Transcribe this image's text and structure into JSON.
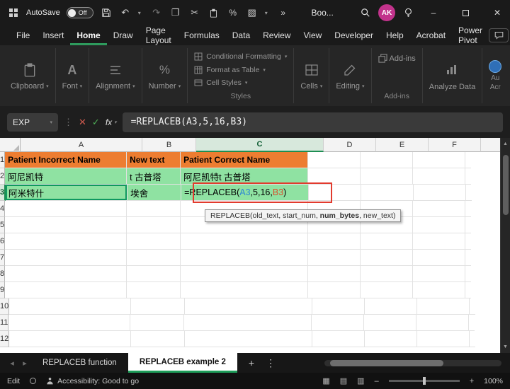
{
  "colors": {
    "accent_green": "#2e9b5d",
    "header_orange": "#ED7D31",
    "cell_green": "#8fe2a2",
    "ref_blue": "#2e86d4",
    "ref_red": "#d94f2b",
    "annotation_red": "#e23b2e",
    "avatar_pink": "#c2338c"
  },
  "title_bar": {
    "autosave_label": "AutoSave",
    "autosave_state": "Off",
    "document_title": "Boo...",
    "avatar_initials": "AK",
    "close_glyph": "✕",
    "minimize_glyph": "–"
  },
  "icons": {
    "undo": "↶",
    "redo": "↷",
    "copy": "❐",
    "cut": "✂",
    "paint": "▨",
    "percent": "%",
    "more": "»",
    "chevron_down": "▾",
    "dots_v": "⋮",
    "nav_left": "◂",
    "nav_right": "▸",
    "add_sheet": "+",
    "view_normal": "▦",
    "view_layout": "▤",
    "view_break": "▥",
    "zoom_out": "–",
    "zoom_in": "+",
    "scroll_up": "▲",
    "scroll_down": "▼",
    "cancel": "✕",
    "enter": "✓"
  },
  "menu_bar": {
    "items": [
      "File",
      "Insert",
      "Home",
      "Draw",
      "Page Layout",
      "Formulas",
      "Data",
      "Review",
      "View",
      "Developer",
      "Help",
      "Acrobat",
      "Power Pivot"
    ],
    "active_item": "Home"
  },
  "ribbon": {
    "groups": [
      {
        "label": "Clipboard"
      },
      {
        "label": "Font"
      },
      {
        "label": "Alignment"
      },
      {
        "label": "Number"
      }
    ],
    "styles_group": {
      "items": [
        "Conditional Formatting",
        "Format as Table",
        "Cell Styles"
      ],
      "label": "Styles"
    },
    "cells_label": "Cells",
    "editing_label": "Editing",
    "addins_button": "Add-ins",
    "addins_label": "Add-ins",
    "analyze_button": "Analyze Data",
    "partial_group": {
      "line1": "Au",
      "line2": "Acr"
    }
  },
  "formula_bar": {
    "name_box": "EXP",
    "fx_label": "fx",
    "formula": "=REPLACEB(A3,5,16,B3)"
  },
  "grid": {
    "column_headers": [
      "A",
      "B",
      "C",
      "D",
      "E",
      "F"
    ],
    "selected_column": "C",
    "row_headers": [
      "1",
      "2",
      "3",
      "4",
      "5",
      "6",
      "7",
      "8",
      "9",
      "10",
      "11",
      "12"
    ],
    "selected_row": "3",
    "cells": {
      "A1": "Patient Incorrect Name",
      "B1": "New text",
      "C1": "Patient Correct Name",
      "A2": "阿尼凯特",
      "B2": "t 古普塔",
      "C2": "阿尼凯特t 古普塔",
      "A3": "阿米特什",
      "B3": "埃舍"
    },
    "c3_formula": {
      "p1": "=REPLACEB(",
      "ref1": "A3",
      "p2": ",5,16,",
      "ref2": "B3",
      "p3": ")"
    },
    "tooltip": {
      "pre": "REPLACEB(old_text, start_num, ",
      "bold": "num_bytes",
      "post": ", new_text)"
    }
  },
  "sheet_tabs": {
    "tabs": [
      {
        "label": "REPLACEB function",
        "active": false
      },
      {
        "label": "REPLACEB example 2",
        "active": true
      }
    ]
  },
  "status_bar": {
    "mode": "Edit",
    "accessibility": "Accessibility: Good to go",
    "zoom_level": "100%"
  }
}
